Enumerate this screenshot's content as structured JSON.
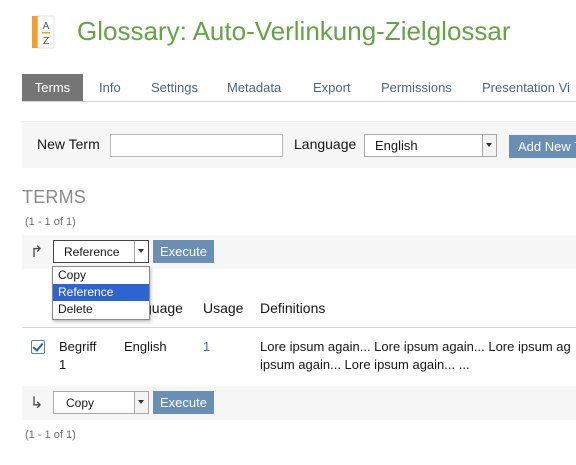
{
  "header": {
    "title": "Glossary: Auto-Verlinkung-Zielglossar",
    "icon": "glossary-az-icon"
  },
  "tabs": [
    {
      "label": "Terms",
      "active": true
    },
    {
      "label": "Info"
    },
    {
      "label": "Settings"
    },
    {
      "label": "Metadata"
    },
    {
      "label": "Export"
    },
    {
      "label": "Permissions"
    },
    {
      "label": "Presentation Vi"
    }
  ],
  "new_term": {
    "label": "New Term",
    "value": "",
    "language_label": "Language",
    "language_value": "English",
    "add_button": "Add New T"
  },
  "terms_section": {
    "title": "TERMS",
    "count_top": "(1 - 1 of 1)",
    "count_bottom": "(1 - 1 of 1)"
  },
  "top_action": {
    "select_value": "Reference",
    "execute": "Execute",
    "options": [
      "Copy",
      "Reference",
      "Delete"
    ],
    "selected_option": "Reference"
  },
  "bottom_action": {
    "select_value": "Copy",
    "execute": "Execute"
  },
  "table": {
    "headers": [
      "guage",
      "Usage",
      "Definitions"
    ],
    "rows": [
      {
        "checked": true,
        "term_line1": "Begriff",
        "term_line2": "1",
        "language": "English",
        "usage": "1",
        "definition_line1": "Lore ipsum again... Lore ipsum again... Lore ipsum ag",
        "definition_line2": "ipsum again... Lore ipsum again... ..."
      }
    ]
  },
  "colors": {
    "title_green": "#65a346",
    "link_blue": "#4c6586",
    "button_blue": "#6b8fb4",
    "menu_highlight": "#2e64cf"
  }
}
